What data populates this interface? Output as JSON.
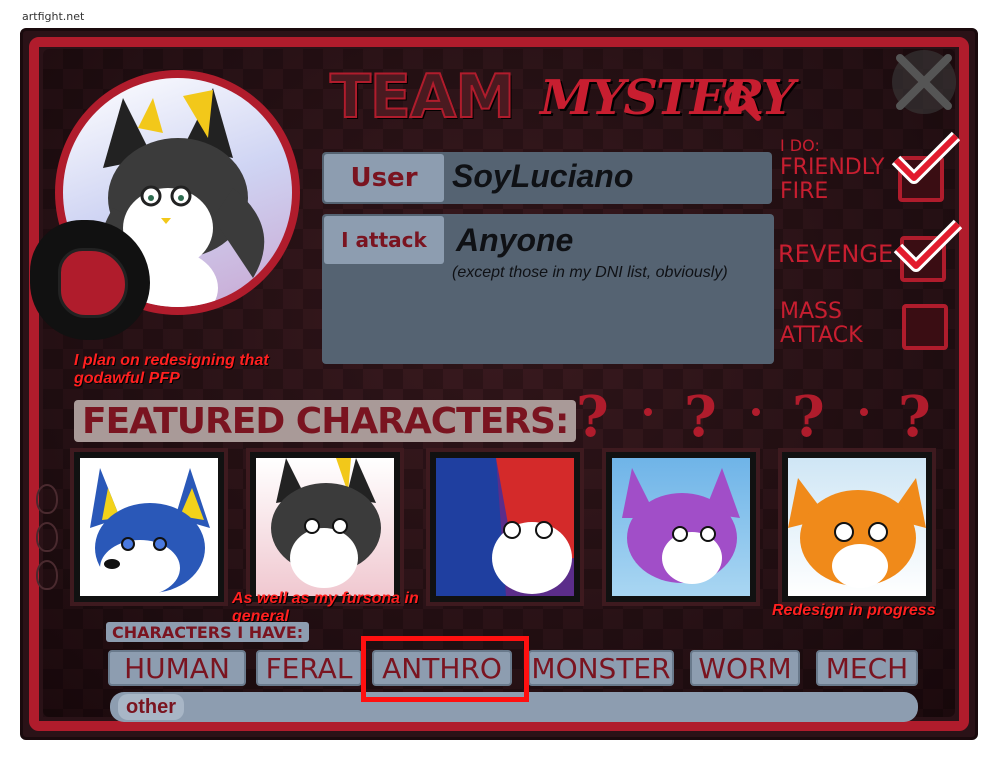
{
  "site": {
    "label": "artfight.net"
  },
  "header": {
    "title_team": "TEAM",
    "title_mystery": "MYSTERY"
  },
  "avatar": {
    "note": "I plan on redesigning that godawful PFP"
  },
  "user_row": {
    "label": "User",
    "value": "SoyLuciano"
  },
  "attack_row": {
    "label": "I attack",
    "value": "Anyone",
    "note": "(except those in my DNI list, obviously)"
  },
  "do_section": {
    "heading": "I DO:",
    "options": [
      {
        "label": "FRIENDLY FIRE",
        "checked": true
      },
      {
        "label": "REVENGE",
        "checked": true
      },
      {
        "label": "MASS ATTACK",
        "checked": false
      }
    ]
  },
  "featured": {
    "title": "FEATURED CHARACTERS:",
    "qmark": "?",
    "notes": {
      "fursona": "As well as my fursona in general",
      "redesign": "Redesign in progress"
    }
  },
  "characters_have": {
    "label": "CHARACTERS I HAVE:",
    "types": [
      "HUMAN",
      "FERAL",
      "ANTHRO",
      "MONSTER",
      "WORM",
      "MECH"
    ],
    "other_label": "other",
    "highlighted": "ANTHRO"
  },
  "colors": {
    "accent": "#b01c2c",
    "panel": "#556372",
    "label_bg": "#8d9db0",
    "highlight": "#ff1010"
  }
}
